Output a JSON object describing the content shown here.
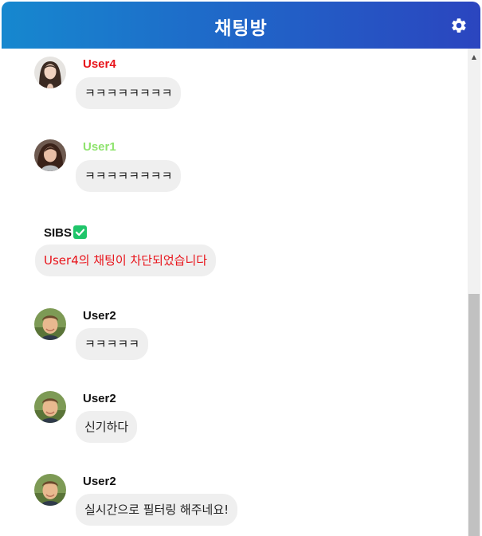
{
  "header": {
    "title": "채팅방",
    "settings_icon": "gear-icon"
  },
  "messages": [
    {
      "user": "User4",
      "text": "ㅋㅋㅋㅋㅋㅋㅋㅋ",
      "name_color": "#e8141b",
      "avatar": "user4-avatar"
    },
    {
      "user": "User1",
      "text": "ㅋㅋㅋㅋㅋㅋㅋㅋ",
      "name_color": "#8fe36e",
      "avatar": "user1-avatar"
    },
    {
      "user": "SIBS",
      "text": "User4의 채팅이 차단되었습니다",
      "name_color": "#111111",
      "text_color": "#e8141b",
      "badge_icon": "verified-check-icon"
    },
    {
      "user": "User2",
      "text": "ㅋㅋㅋㅋㅋ",
      "name_color": "#111111",
      "avatar": "user2-avatar"
    },
    {
      "user": "User2",
      "text": "신기하다",
      "name_color": "#111111",
      "avatar": "user2-avatar"
    },
    {
      "user": "User2",
      "text": "실시간으로 필터링 해주네요!",
      "name_color": "#111111",
      "avatar": "user2-avatar"
    }
  ],
  "colors": {
    "header_gradient_start": "#1688cf",
    "header_gradient_end": "#2b45bf",
    "bubble_bg": "#efefef",
    "system_text": "#e8141b",
    "verified_badge": "#1fc56a"
  }
}
